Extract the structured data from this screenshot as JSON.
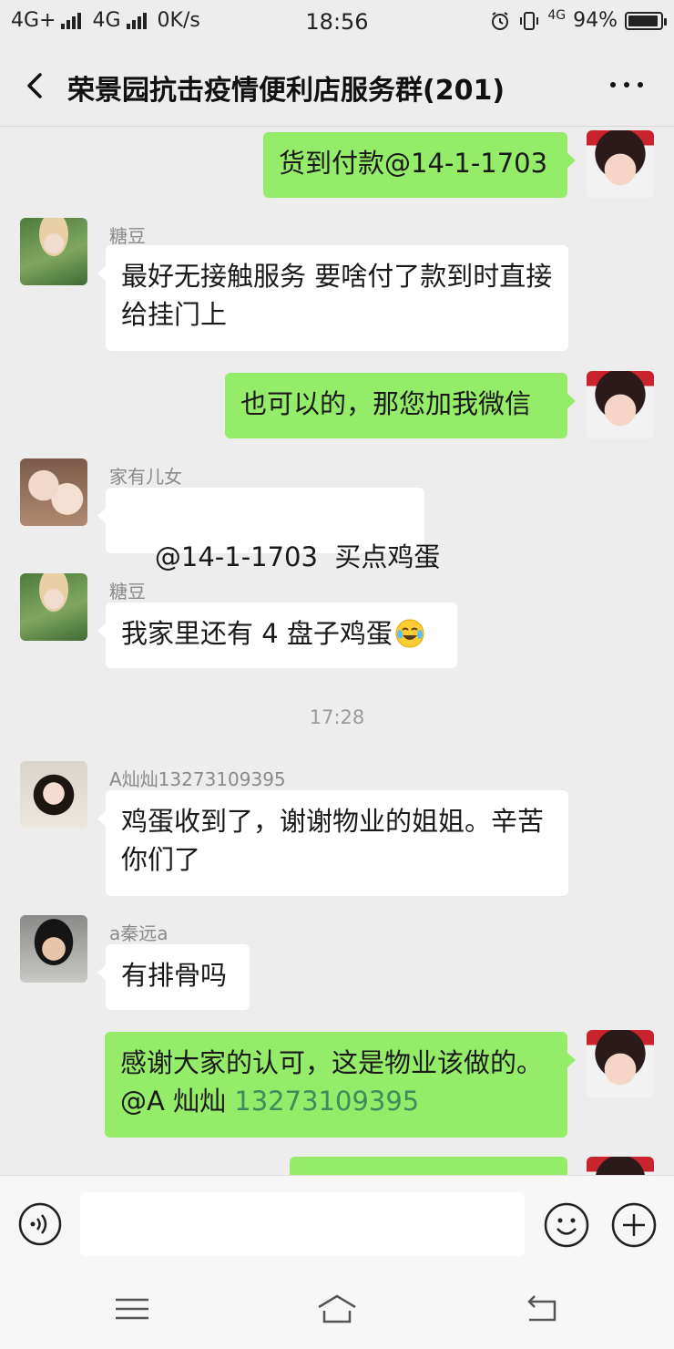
{
  "status_bar": {
    "network1": "4G+",
    "network2": "4G",
    "speed": "0K/s",
    "time": "18:56",
    "network3": "4G",
    "battery_text": "94%",
    "battery_level": 0.94
  },
  "header": {
    "title": "荣景园抗击疫情便利店服务群(201)"
  },
  "messages": [
    {
      "text": "货到付款@14-1-1703"
    },
    {
      "sender": "糖豆",
      "text": "最好无接触服务 要啥付了款到时直接给挂门上"
    },
    {
      "text": "也可以的，那您加我微信"
    },
    {
      "sender": "家有儿女",
      "text": "@14-1-1703  买点鸡蛋"
    },
    {
      "sender": "糖豆",
      "text": "我家里还有 4 盘子鸡蛋"
    },
    {
      "sender": "A灿灿13273109395",
      "text": "鸡蛋收到了，谢谢物业的姐姐。辛苦你们了"
    },
    {
      "sender": "a秦远a",
      "text": "有排骨吗"
    },
    {
      "text": "感谢大家的认可，这是物业该做的。",
      "mention_name": "@A 灿灿 ",
      "mention_number": "13273109395"
    }
  ],
  "timestamp": "17:28",
  "colors": {
    "outgoing_bubble": "#95ec69",
    "incoming_bubble": "#ffffff",
    "background": "#ededed",
    "mention": "#3d8d5c"
  },
  "icons": {
    "back": "chevron-left-icon",
    "more": "more-dots-icon",
    "voice": "voice-icon",
    "emoji": "smiley-icon",
    "plus": "plus-icon",
    "laugh": "laugh-cry-emoji",
    "menu": "menu-icon",
    "home": "home-icon",
    "return": "back-icon"
  }
}
